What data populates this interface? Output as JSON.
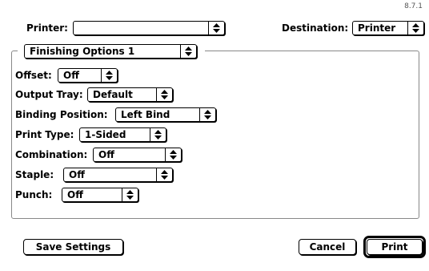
{
  "version": "8.7.1",
  "printer": {
    "label": "Printer:",
    "value": ""
  },
  "destination": {
    "label": "Destination:",
    "value": "Printer"
  },
  "panel": {
    "selector": "Finishing Options 1"
  },
  "options": {
    "offset": {
      "label": "Offset:",
      "value": "Off"
    },
    "output_tray": {
      "label": "Output Tray:",
      "value": "Default"
    },
    "binding_position": {
      "label": "Binding Position:",
      "value": "Left Bind"
    },
    "print_type": {
      "label": "Print Type:",
      "value": "1-Sided"
    },
    "combination": {
      "label": "Combination:",
      "value": "Off"
    },
    "staple": {
      "label": "Staple:",
      "value": "Off"
    },
    "punch": {
      "label": "Punch:",
      "value": "Off"
    }
  },
  "buttons": {
    "save": "Save Settings",
    "cancel": "Cancel",
    "print": "Print"
  },
  "icons": {
    "popup_arrows": "up-down-arrows-icon"
  }
}
